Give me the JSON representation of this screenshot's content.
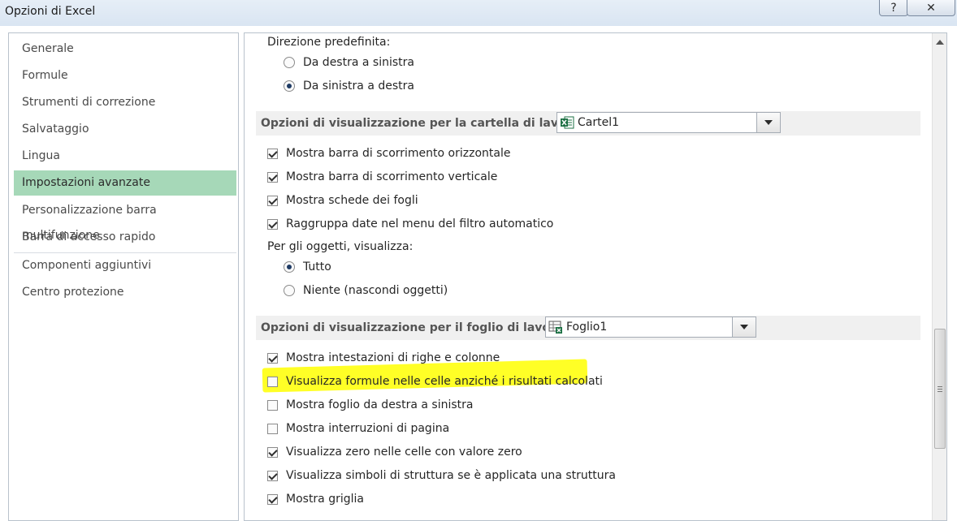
{
  "window": {
    "title": "Opzioni di Excel",
    "help_label": "?",
    "close_label": "✕"
  },
  "nav": {
    "items": [
      {
        "label": "Generale"
      },
      {
        "label": "Formule"
      },
      {
        "label": "Strumenti di correzione"
      },
      {
        "label": "Salvataggio"
      },
      {
        "label": "Lingua"
      },
      {
        "label": "Impostazioni avanzate",
        "selected": true
      },
      {
        "label": "Personalizzazione barra multifunzione"
      },
      {
        "label": "Barra di accesso rapido"
      },
      {
        "label": "Componenti aggiuntivi"
      },
      {
        "label": "Centro protezione"
      }
    ]
  },
  "direction": {
    "label": "Direzione predefinita:",
    "options": [
      {
        "label": "Da destra a sinistra",
        "checked": false
      },
      {
        "label": "Da sinistra a destra",
        "checked": true
      }
    ]
  },
  "workbook_section": {
    "header": "Opzioni di visualizzazione per la cartella di lavoro:",
    "selected": "Cartel1",
    "options": [
      {
        "label": "Mostra barra di scorrimento orizzontale",
        "checked": true
      },
      {
        "label": "Mostra barra di scorrimento verticale",
        "checked": true
      },
      {
        "label": "Mostra schede dei fogli",
        "checked": true
      },
      {
        "label": "Raggruppa date nel menu del filtro automatico",
        "checked": true
      }
    ],
    "objects_label": "Per gli oggetti, visualizza:",
    "objects_options": [
      {
        "label": "Tutto",
        "checked": true
      },
      {
        "label": "Niente (nascondi oggetti)",
        "checked": false
      }
    ]
  },
  "worksheet_section": {
    "header": "Opzioni di visualizzazione per il foglio di lavoro:",
    "selected": "Foglio1",
    "options": [
      {
        "label": "Mostra intestazioni di righe e colonne",
        "checked": true
      },
      {
        "label": "Visualizza formule nelle celle anziché i risultati calcolati",
        "checked": false,
        "highlighted": true
      },
      {
        "label": "Mostra foglio da destra a sinistra",
        "checked": false
      },
      {
        "label": "Mostra interruzioni di pagina",
        "checked": false
      },
      {
        "label": "Visualizza zero nelle celle con valore zero",
        "checked": true
      },
      {
        "label": "Visualizza simboli di struttura se è applicata una struttura",
        "checked": true
      },
      {
        "label": "Mostra griglia",
        "checked": true
      }
    ]
  },
  "colors": {
    "nav_selected": "#a6d8b8",
    "highlighter": "#ffff00",
    "excel_green": "#1e7145"
  }
}
